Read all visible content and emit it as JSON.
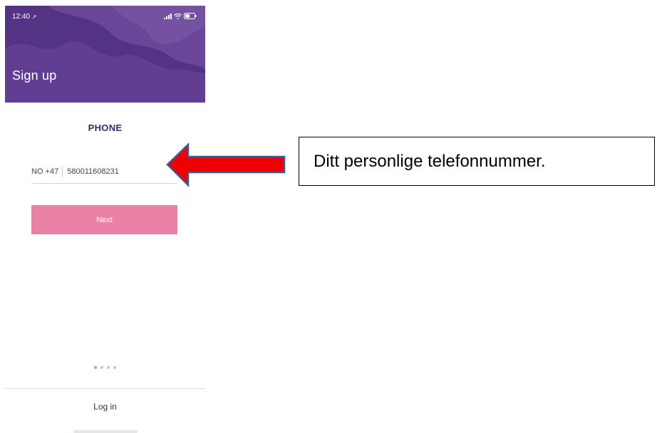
{
  "status_bar": {
    "time": "12:40",
    "icons": [
      "location-arrow-icon",
      "signal-icon",
      "wifi-icon",
      "battery-icon"
    ]
  },
  "header": {
    "title": "Sign up"
  },
  "form": {
    "section_title": "PHONE",
    "country_code": "NO +47",
    "phone_value": "580011608231",
    "next_label": "Next"
  },
  "pager": {
    "total": 4,
    "active_index": 0
  },
  "footer": {
    "login_label": "Log in"
  },
  "annotation": {
    "callout_text": "Ditt personlige telefonnummer."
  },
  "colors": {
    "header_purple": "#5d3a8c",
    "title_navy": "#2e2f62",
    "accent_pink": "#ea81a6",
    "arrow_red": "#ee0000",
    "arrow_outline": "#3f5b93"
  }
}
